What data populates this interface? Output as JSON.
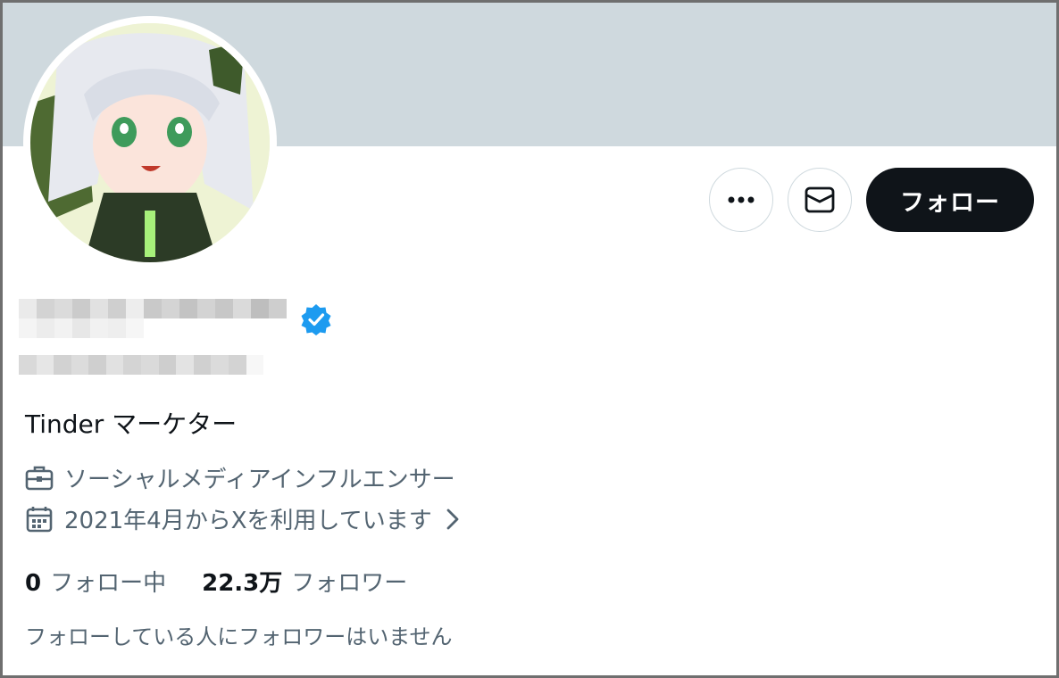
{
  "profile": {
    "bio": "Tinder マーケター",
    "job": "ソーシャルメディアインフルエンサー",
    "joined": "2021年4月からXを利用しています"
  },
  "actions": {
    "follow_label": "フォロー"
  },
  "stats": {
    "following_count": "0",
    "following_label": "フォロー中",
    "followers_count": "22.3万",
    "followers_label": "フォロワー"
  },
  "notice": "フォローしている人にフォロワーはいません",
  "icons": {
    "more": "more-icon",
    "message": "mail-icon",
    "verified": "verified-badge-icon",
    "job": "briefcase-icon",
    "joined": "calendar-icon",
    "chevron": "chevron-right-icon"
  },
  "colors": {
    "banner": "#cfd9de",
    "follow_button": "#0f1419",
    "verified": "#1d9bf0",
    "secondary_text": "#536471"
  }
}
